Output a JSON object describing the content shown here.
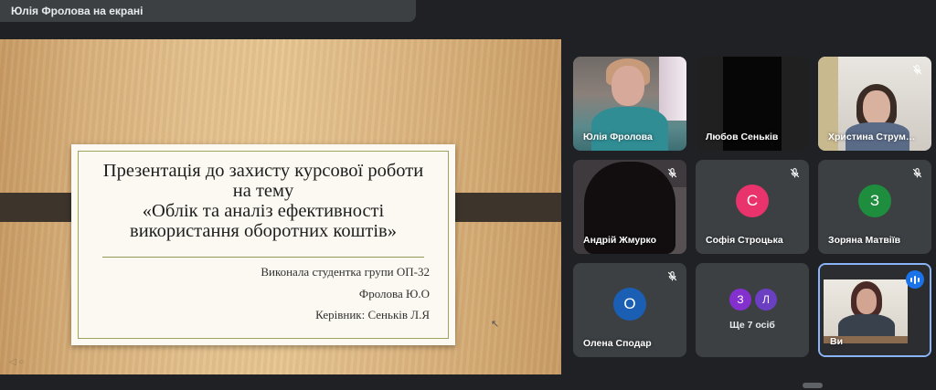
{
  "presenter": {
    "label": "Юлія Фролова на екрані"
  },
  "slide": {
    "title": "Презентація до захисту курсової роботи\nна тему\n«Облік та аналіз ефективності\nвикористання оборотних коштів»",
    "lines": [
      "Виконала студентка  групи ОП-32",
      "Фролова Ю.О",
      "Керівник: Сеньків Л.Я"
    ]
  },
  "participants": [
    {
      "name": "Юлія Фролова",
      "muted": false,
      "video": true
    },
    {
      "name": "Любов Сеньків",
      "muted": false,
      "video": true
    },
    {
      "name": "Христина Струм…",
      "muted": true,
      "video": true
    },
    {
      "name": "Андрій Жмурко",
      "muted": true,
      "video": true
    },
    {
      "name": "Софія Строцька",
      "muted": true,
      "video": false,
      "initial": "С",
      "color": "#e8336c"
    },
    {
      "name": "Зоряна Матвіїв",
      "muted": true,
      "video": false,
      "initial": "З",
      "color": "#1e8e3e"
    },
    {
      "name": "Олена Сподар",
      "muted": true,
      "video": false,
      "initial": "О",
      "color": "#1a5fb4"
    },
    {
      "name": "Ви",
      "muted": false,
      "video": true,
      "speaking": true
    }
  ],
  "more": {
    "label": "Ще 7 осіб",
    "initials": [
      "З",
      "Л"
    ],
    "colors": [
      "#8430ce",
      "#6a3fc2"
    ]
  },
  "icons": {
    "mute": "mic-off-icon",
    "speaking": "audio-level-icon"
  }
}
